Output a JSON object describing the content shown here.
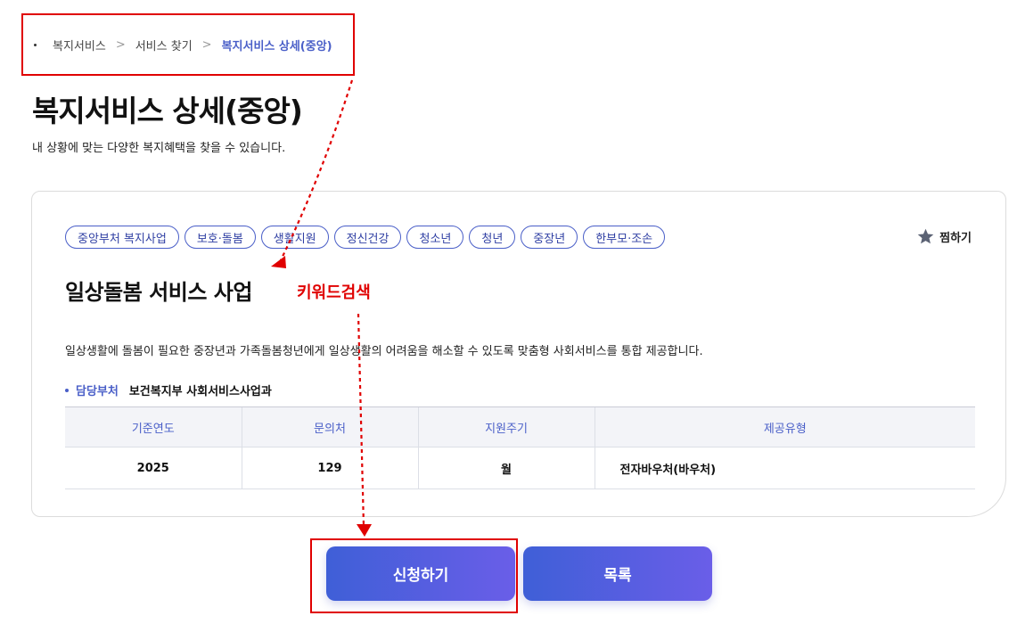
{
  "breadcrumb": {
    "items": [
      "복지서비스",
      "서비스 찾기"
    ],
    "current": "복지서비스 상세(중앙)",
    "separator": ">"
  },
  "page": {
    "title": "복지서비스 상세(중앙)",
    "subtitle": "내 상황에 맞는 다양한 복지혜택을 찾을 수 있습니다."
  },
  "service": {
    "tags": [
      "중앙부처 복지사업",
      "보호·돌봄",
      "생활지원",
      "정신건강",
      "청소년",
      "청년",
      "중장년",
      "한부모·조손"
    ],
    "bookmark_label": "찜하기",
    "title": "일상돌봄 서비스 사업",
    "description": "일상생활에 돌봄이 필요한 중장년과 가족돌봄청년에게 일상생활의 어려움을 해소할 수 있도록 맞춤형 사회서비스를 통합 제공합니다.",
    "department_label": "담당부처",
    "department_value": "보건복지부 사회서비스사업과"
  },
  "table": {
    "headers": [
      "기준연도",
      "문의처",
      "지원주기",
      "제공유형"
    ],
    "row": [
      "2025",
      "129",
      "월",
      "전자바우처(바우처)"
    ]
  },
  "annotation": {
    "text": "키워드검색",
    "color": "#e00000"
  },
  "buttons": {
    "apply": "신청하기",
    "list": "목록"
  },
  "colors": {
    "accent": "#4a5fc8",
    "highlight": "#e00000",
    "button_gradient_start": "#3f5fd7",
    "button_gradient_end": "#6a5ee8"
  },
  "icons": {
    "bookmark": "star-icon",
    "breadcrumb_separator": "chevron-right-icon"
  }
}
